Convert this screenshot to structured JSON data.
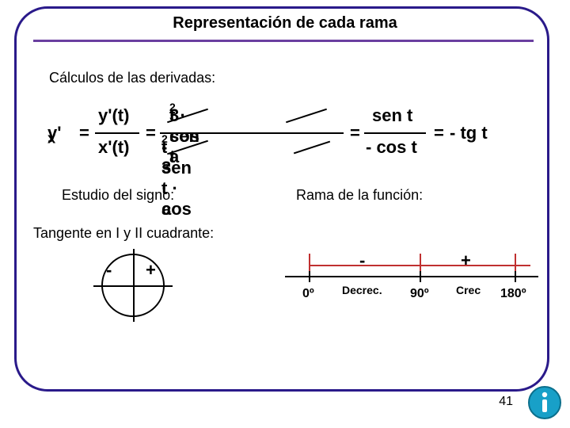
{
  "title": "Representación de cada rama",
  "headers": {
    "calc": "Cálculos de las derivadas:",
    "sign": "Estudio del signo:",
    "rama": "Rama de la función:",
    "tangent": "Tangente en I y II cuadrante:"
  },
  "formula": {
    "lhs": "y'",
    "lhs_sub": "x",
    "eq1": "=",
    "frac1_top": "y'(t)",
    "frac1_bot": "x'(t)",
    "eq2": "=",
    "frac2_top_a": "3 · a",
    "frac2_top_b": "· sen",
    "frac2_top_exp": "2",
    "frac2_top_c": "t · cos t",
    "frac2_bot_a": "- 3 · a",
    "frac2_bot_b": "· sen t · cos",
    "frac2_bot_exp": "2",
    "frac2_bot_c": "t",
    "eq3": "=",
    "frac3_top": "sen t",
    "frac3_bot": "- cos t",
    "eq4": "=",
    "rhs": "- tg t"
  },
  "circle": {
    "minus": "-",
    "plus": "+"
  },
  "rama_line": {
    "sign_minus": "-",
    "sign_plus": "+",
    "tick0": "0º",
    "decrec": "Decrec.",
    "tick90": "90º",
    "crec": "Crec",
    "tick180": "180º"
  },
  "page_number": "41"
}
